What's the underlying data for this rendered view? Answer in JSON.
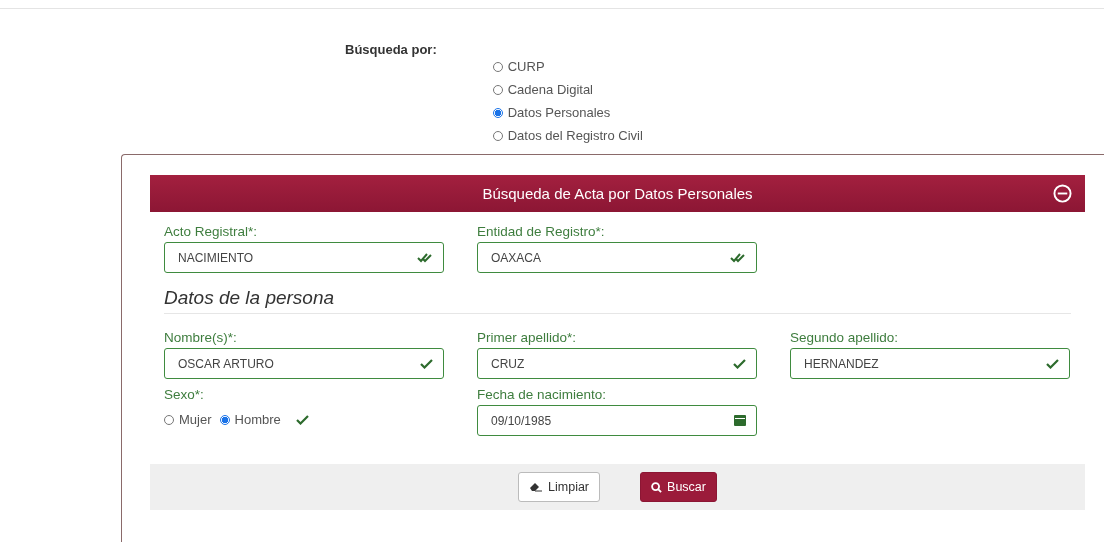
{
  "search_by": {
    "label": "Búsqueda por:",
    "options": [
      {
        "label": "CURP",
        "selected": false
      },
      {
        "label": "Cadena Digital",
        "selected": false
      },
      {
        "label": "Datos Personales",
        "selected": true
      },
      {
        "label": "Datos del Registro Civil",
        "selected": false
      }
    ]
  },
  "panel": {
    "title": "Búsqueda de Acta por Datos Personales",
    "expanded": true,
    "registry_fields": [
      {
        "label": "Acto Registral*:",
        "value": "NACIMIENTO",
        "kind": "select"
      },
      {
        "label": "Entidad de Registro*:",
        "value": "OAXACA",
        "kind": "select"
      }
    ],
    "section_title": "Datos de la persona",
    "person_fields": [
      {
        "label": "Nombre(s)*:",
        "value": "OSCAR ARTURO",
        "kind": "text"
      },
      {
        "label": "Primer apellido*:",
        "value": "CRUZ",
        "kind": "text"
      },
      {
        "label": "Segundo apellido:",
        "value": "HERNANDEZ",
        "kind": "text"
      }
    ],
    "sex": {
      "label": "Sexo*:",
      "options": [
        {
          "label": "Mujer",
          "selected": false
        },
        {
          "label": "Hombre",
          "selected": true
        }
      ]
    },
    "birth_date": {
      "label": "Fecha de nacimiento:",
      "value": "09/10/1985",
      "kind": "date"
    },
    "buttons": [
      {
        "label": "Limpiar",
        "kind": "clear"
      },
      {
        "label": "Buscar",
        "kind": "search"
      }
    ]
  }
}
